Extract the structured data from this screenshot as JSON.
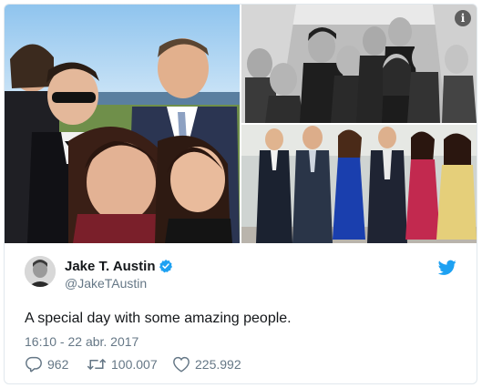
{
  "tweet": {
    "author_name": "Jake T. Austin",
    "author_handle": "@JakeTAustin",
    "text": "A special day with some amazing people.",
    "timestamp": "16:10 - 22 abr. 2017",
    "replies": "962",
    "retweets": "100.007",
    "likes": "225.992"
  },
  "colors": {
    "twitter_blue": "#1da1f2",
    "text_primary": "#14171a",
    "text_secondary": "#657786"
  },
  "icons": {
    "verified": "verified-badge-icon",
    "brand": "twitter-bird-icon",
    "reply": "reply-bubble-icon",
    "retweet": "retweet-arrows-icon",
    "like": "heart-icon",
    "info": "info-icon"
  }
}
